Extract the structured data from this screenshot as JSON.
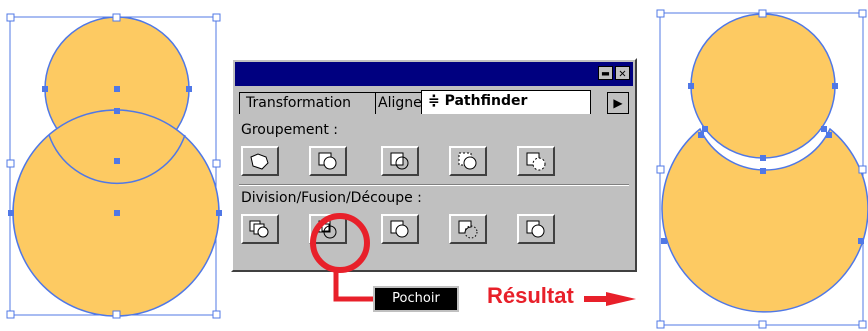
{
  "panel": {
    "tabs": [
      {
        "label": "Transformation"
      },
      {
        "label": "Alignement"
      },
      {
        "label": "≑ Pathfinder"
      }
    ],
    "tab_scroll_icon": "triangle-right",
    "window_buttons": [
      "minimize",
      "close"
    ],
    "groups": [
      {
        "label": "Groupement :",
        "buttons": [
          "unite-icon",
          "intersect-icon",
          "exclude-icon",
          "add-icon",
          "subtract-icon"
        ]
      },
      {
        "label": "Division/Fusion/Découpe :",
        "buttons": [
          "divide-icon",
          "stencil-icon",
          "trim-icon",
          "outline-icon",
          "crop-icon"
        ]
      }
    ]
  },
  "callout": {
    "tooltip": "Pochoir",
    "result_label": "Résultat"
  },
  "colors": {
    "shape_fill": "#fdca62",
    "selection": "#5078e6",
    "highlight": "#e8202a",
    "panel_bg": "#c0c0c0",
    "titlebar": "#000080"
  }
}
